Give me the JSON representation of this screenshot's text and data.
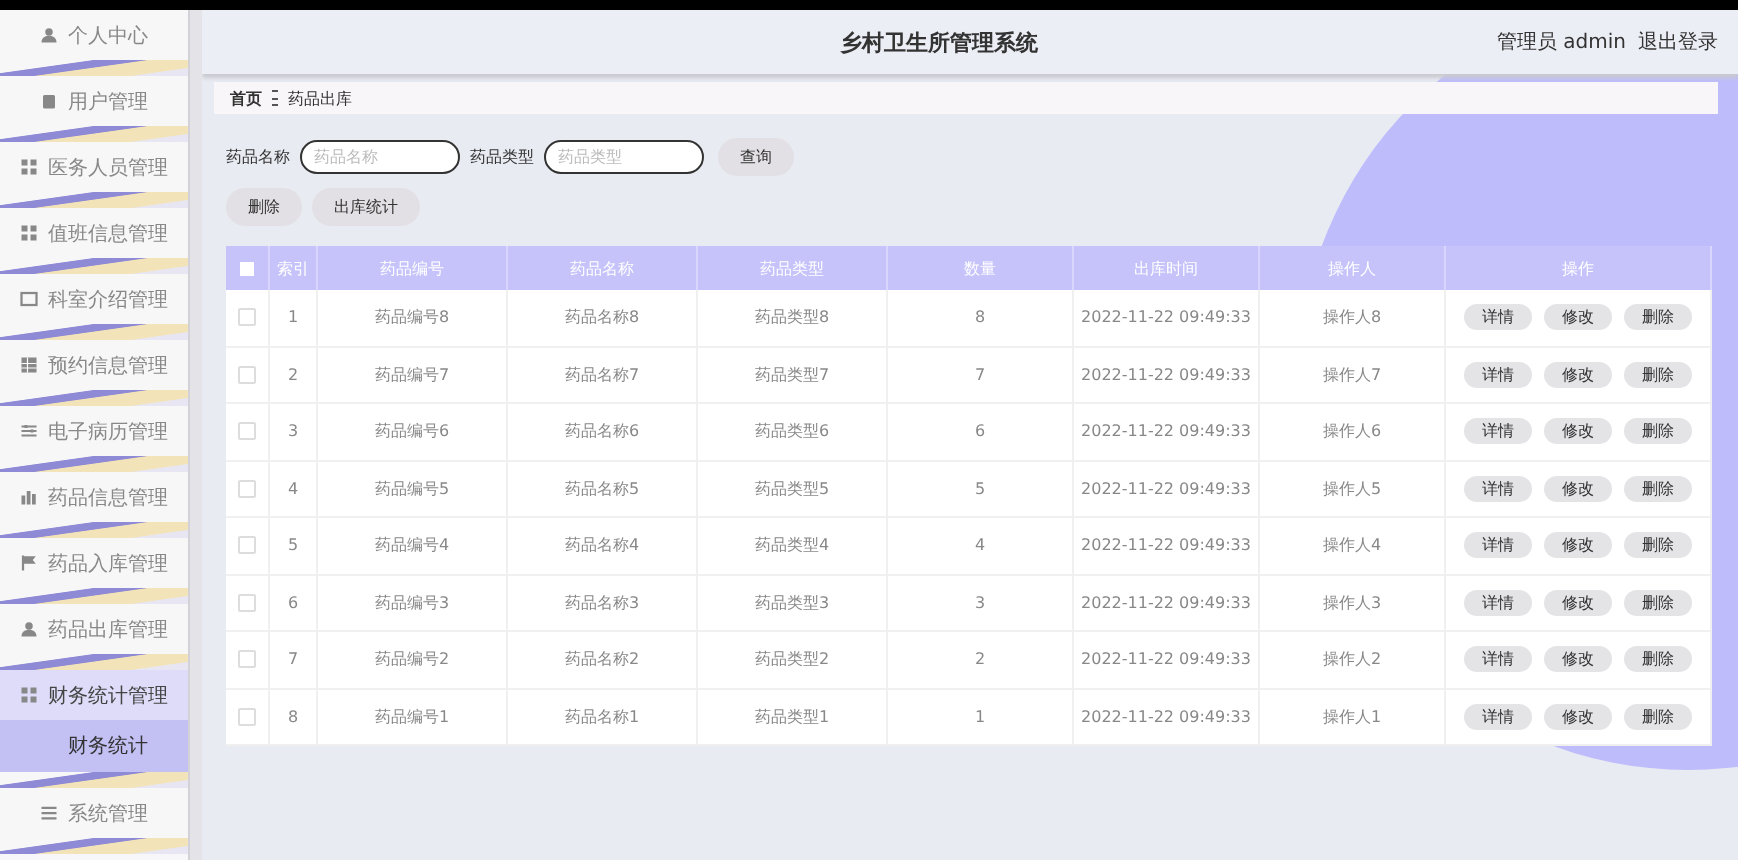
{
  "sidebar": {
    "items": [
      {
        "label": "个人中心",
        "selected": false
      },
      {
        "label": "用户管理",
        "selected": false
      },
      {
        "label": "医务人员管理",
        "selected": false
      },
      {
        "label": "值班信息管理",
        "selected": false
      },
      {
        "label": "科室介绍管理",
        "selected": false
      },
      {
        "label": "预约信息管理",
        "selected": false
      },
      {
        "label": "电子病历管理",
        "selected": false
      },
      {
        "label": "药品信息管理",
        "selected": false
      },
      {
        "label": "药品入库管理",
        "selected": false
      },
      {
        "label": "药品出库管理",
        "selected": false
      },
      {
        "label": "财务统计管理",
        "selected": false,
        "expanded": true,
        "children": [
          {
            "label": "财务统计",
            "selected": true
          }
        ]
      },
      {
        "label": "系统管理",
        "selected": false
      }
    ]
  },
  "header": {
    "title": "乡村卫生所管理系统",
    "user": "管理员 admin",
    "logout": "退出登录"
  },
  "breadcrumb": [
    "首页",
    "药品出库"
  ],
  "search": {
    "fields": [
      {
        "label": "药品名称",
        "placeholder": "药品名称"
      },
      {
        "label": "药品类型",
        "placeholder": "药品类型"
      }
    ],
    "button": "查询"
  },
  "actions": [
    "删除",
    "出库统计"
  ],
  "table": {
    "select_all_checked": false,
    "columns": [
      "索引",
      "药品编号",
      "药品名称",
      "药品类型",
      "数量",
      "出库时间",
      "操作人",
      "操作"
    ],
    "rows": [
      {
        "checked": false,
        "cells": [
          "1",
          "药品编号8",
          "药品名称8",
          "药品类型8",
          "8",
          "2022-11-22 09:49:33",
          "操作人8"
        ],
        "buttons": [
          "详情",
          "修改",
          "删除"
        ]
      },
      {
        "checked": false,
        "cells": [
          "2",
          "药品编号7",
          "药品名称7",
          "药品类型7",
          "7",
          "2022-11-22 09:49:33",
          "操作人7"
        ],
        "buttons": [
          "详情",
          "修改",
          "删除"
        ]
      },
      {
        "checked": false,
        "cells": [
          "3",
          "药品编号6",
          "药品名称6",
          "药品类型6",
          "6",
          "2022-11-22 09:49:33",
          "操作人6"
        ],
        "buttons": [
          "详情",
          "修改",
          "删除"
        ]
      },
      {
        "checked": false,
        "cells": [
          "4",
          "药品编号5",
          "药品名称5",
          "药品类型5",
          "5",
          "2022-11-22 09:49:33",
          "操作人5"
        ],
        "buttons": [
          "详情",
          "修改",
          "删除"
        ]
      },
      {
        "checked": false,
        "cells": [
          "5",
          "药品编号4",
          "药品名称4",
          "药品类型4",
          "4",
          "2022-11-22 09:49:33",
          "操作人4"
        ],
        "buttons": [
          "详情",
          "修改",
          "删除"
        ]
      },
      {
        "checked": false,
        "cells": [
          "6",
          "药品编号3",
          "药品名称3",
          "药品类型3",
          "3",
          "2022-11-22 09:49:33",
          "操作人3"
        ],
        "buttons": [
          "详情",
          "修改",
          "删除"
        ]
      },
      {
        "checked": false,
        "cells": [
          "7",
          "药品编号2",
          "药品名称2",
          "药品类型2",
          "2",
          "2022-11-22 09:49:33",
          "操作人2"
        ],
        "buttons": [
          "详情",
          "修改",
          "删除"
        ]
      },
      {
        "checked": false,
        "cells": [
          "8",
          "药品编号1",
          "药品名称1",
          "药品类型1",
          "1",
          "2022-11-22 09:49:33",
          "操作人1"
        ],
        "buttons": [
          "详情",
          "修改",
          "删除"
        ]
      }
    ]
  }
}
